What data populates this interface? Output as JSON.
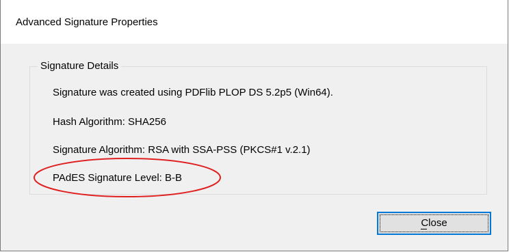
{
  "dialog": {
    "title": "Advanced Signature Properties"
  },
  "group": {
    "legend": "Signature Details",
    "details": [
      "Signature was created using PDFlib PLOP DS 5.2p5 (Win64).",
      "Hash Algorithm: SHA256",
      "Signature Algorithm: RSA with SSA-PSS (PKCS#1 v.2.1)",
      "PAdES Signature Level: B-B"
    ]
  },
  "buttons": {
    "close_label": "Close"
  },
  "colors": {
    "highlight": "#e02020",
    "focus_border": "#0078d7",
    "dialog_bg": "#f0f0f0"
  }
}
